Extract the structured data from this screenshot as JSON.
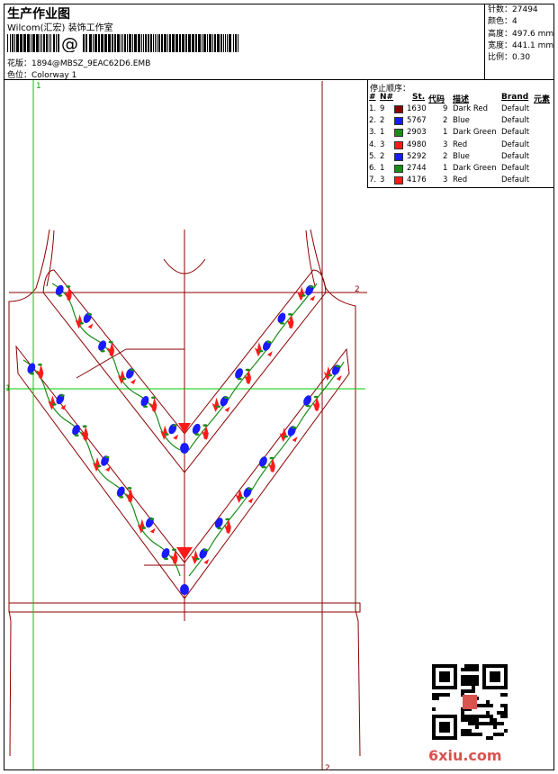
{
  "header": {
    "title": "生产作业图",
    "studio": "Wilcom(汇宏) 装饰工作室",
    "design_file_label": "花版：",
    "design_file": "1894@MBSZ_9EAC62D6.EMB",
    "colorway_label": "色位：",
    "colorway": "Colorway 1"
  },
  "stats": [
    {
      "label": "针数：",
      "value": "27494"
    },
    {
      "label": "颜色：",
      "value": "4"
    },
    {
      "label": "高度：",
      "value": "497.6 mm"
    },
    {
      "label": "宽度：",
      "value": "441.1 mm"
    },
    {
      "label": "比例：",
      "value": "0.30"
    }
  ],
  "legend": {
    "title": "停止顺序：",
    "headers": [
      "#",
      "N#",
      "St.",
      "代码",
      "描述",
      "Brand",
      "元素"
    ],
    "rows": [
      {
        "idx": "1.",
        "n": "9",
        "st": "1630",
        "code": "9",
        "desc": "Dark Red",
        "brand": "Default",
        "color": "#8b0000"
      },
      {
        "idx": "2.",
        "n": "2",
        "st": "5767",
        "code": "2",
        "desc": "Blue",
        "brand": "Default",
        "color": "#1a1aff"
      },
      {
        "idx": "3.",
        "n": "1",
        "st": "2903",
        "code": "1",
        "desc": "Dark Green",
        "brand": "Default",
        "color": "#1a8c1a"
      },
      {
        "idx": "4.",
        "n": "3",
        "st": "4980",
        "code": "3",
        "desc": "Red",
        "brand": "Default",
        "color": "#ff1a1a"
      },
      {
        "idx": "5.",
        "n": "2",
        "st": "5292",
        "code": "2",
        "desc": "Blue",
        "brand": "Default",
        "color": "#1a1aff"
      },
      {
        "idx": "6.",
        "n": "1",
        "st": "2744",
        "code": "1",
        "desc": "Dark Green",
        "brand": "Default",
        "color": "#1a8c1a"
      },
      {
        "idx": "7.",
        "n": "3",
        "st": "4176",
        "code": "3",
        "desc": "Red",
        "brand": "Default",
        "color": "#ff1a1a"
      }
    ]
  },
  "guides": {
    "v1": "1",
    "h1": "1",
    "h2": "2",
    "v2": "2"
  },
  "watermark": {
    "site": "6xiu.com"
  },
  "colors": {
    "outline": "#8b0000",
    "guide": "#00cc00",
    "red": "#ff1a1a",
    "blue": "#1a1aff",
    "green": "#1a8c1a"
  }
}
